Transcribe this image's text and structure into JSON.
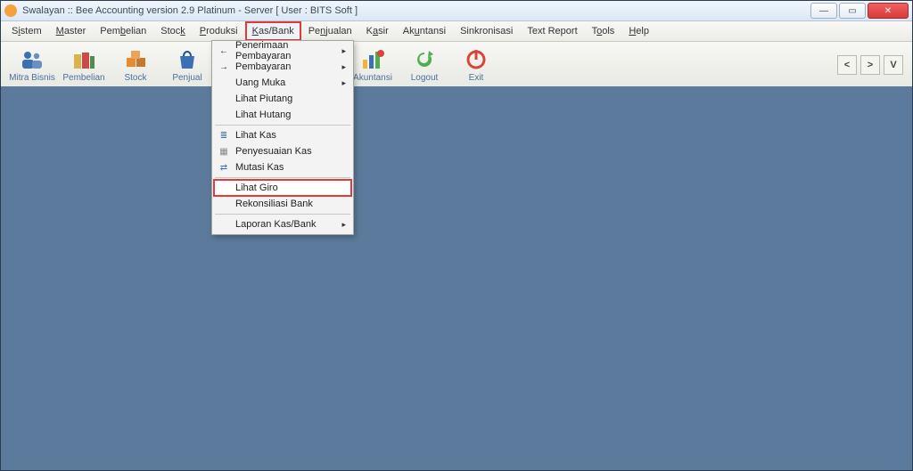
{
  "titlebar": {
    "title": "Swalayan :: Bee Accounting version 2.9 Platinum - Server   [ User : BITS Soft ]"
  },
  "menubar": {
    "items": [
      {
        "label": "Sistem",
        "mnemonic": "i"
      },
      {
        "label": "Master",
        "mnemonic": "M"
      },
      {
        "label": "Pembelian",
        "mnemonic": "b"
      },
      {
        "label": "Stock",
        "mnemonic": "k"
      },
      {
        "label": "Produksi",
        "mnemonic": "P"
      },
      {
        "label": "Kas/Bank",
        "mnemonic": "K",
        "active": true,
        "highlight": "red-box"
      },
      {
        "label": "Penjualan",
        "mnemonic": "n"
      },
      {
        "label": "Kasir",
        "mnemonic": "a"
      },
      {
        "label": "Akuntansi",
        "mnemonic": "u"
      },
      {
        "label": "Sinkronisasi"
      },
      {
        "label": "Text Report"
      },
      {
        "label": "Tools",
        "mnemonic": "o"
      },
      {
        "label": "Help",
        "mnemonic": "H"
      }
    ]
  },
  "toolbar": {
    "items": [
      {
        "label": "Mitra Bisnis",
        "icon": "people-icon"
      },
      {
        "label": "Pembelian",
        "icon": "books-icon"
      },
      {
        "label": "Stock",
        "icon": "boxes-icon"
      },
      {
        "label": "Penjual",
        "icon": "bag-icon"
      },
      {
        "label": "Akuntansi",
        "icon": "chart-icon"
      },
      {
        "label": "Logout",
        "icon": "refresh-icon"
      },
      {
        "label": "Exit",
        "icon": "power-icon"
      }
    ],
    "nav": {
      "prev": "<",
      "next": ">",
      "drop": "V"
    }
  },
  "dropdown": {
    "for_menu": "Kas/Bank",
    "items": [
      {
        "label": "Penerimaan Pembayaran",
        "submenu": true,
        "icon": "arrow-left-icon"
      },
      {
        "label": "Pembayaran",
        "submenu": true,
        "icon": "arrow-right-icon"
      },
      {
        "label": "Uang Muka",
        "submenu": true
      },
      {
        "label": "Lihat Piutang"
      },
      {
        "label": "Lihat Hutang"
      },
      {
        "label": "Lihat Kas",
        "icon": "list-icon"
      },
      {
        "label": "Penyesuaian Kas",
        "icon": "adjust-icon"
      },
      {
        "label": "Mutasi Kas",
        "icon": "transfer-icon"
      },
      {
        "label": "Lihat Giro",
        "highlight": "red-box"
      },
      {
        "label": "Rekonsiliasi Bank"
      },
      {
        "label": "Laporan Kas/Bank",
        "submenu": true
      }
    ]
  },
  "colors": {
    "workspace_bg": "#5c7b9c",
    "highlight_outline": "#e13a3a",
    "link_text": "#4a6fa0"
  }
}
